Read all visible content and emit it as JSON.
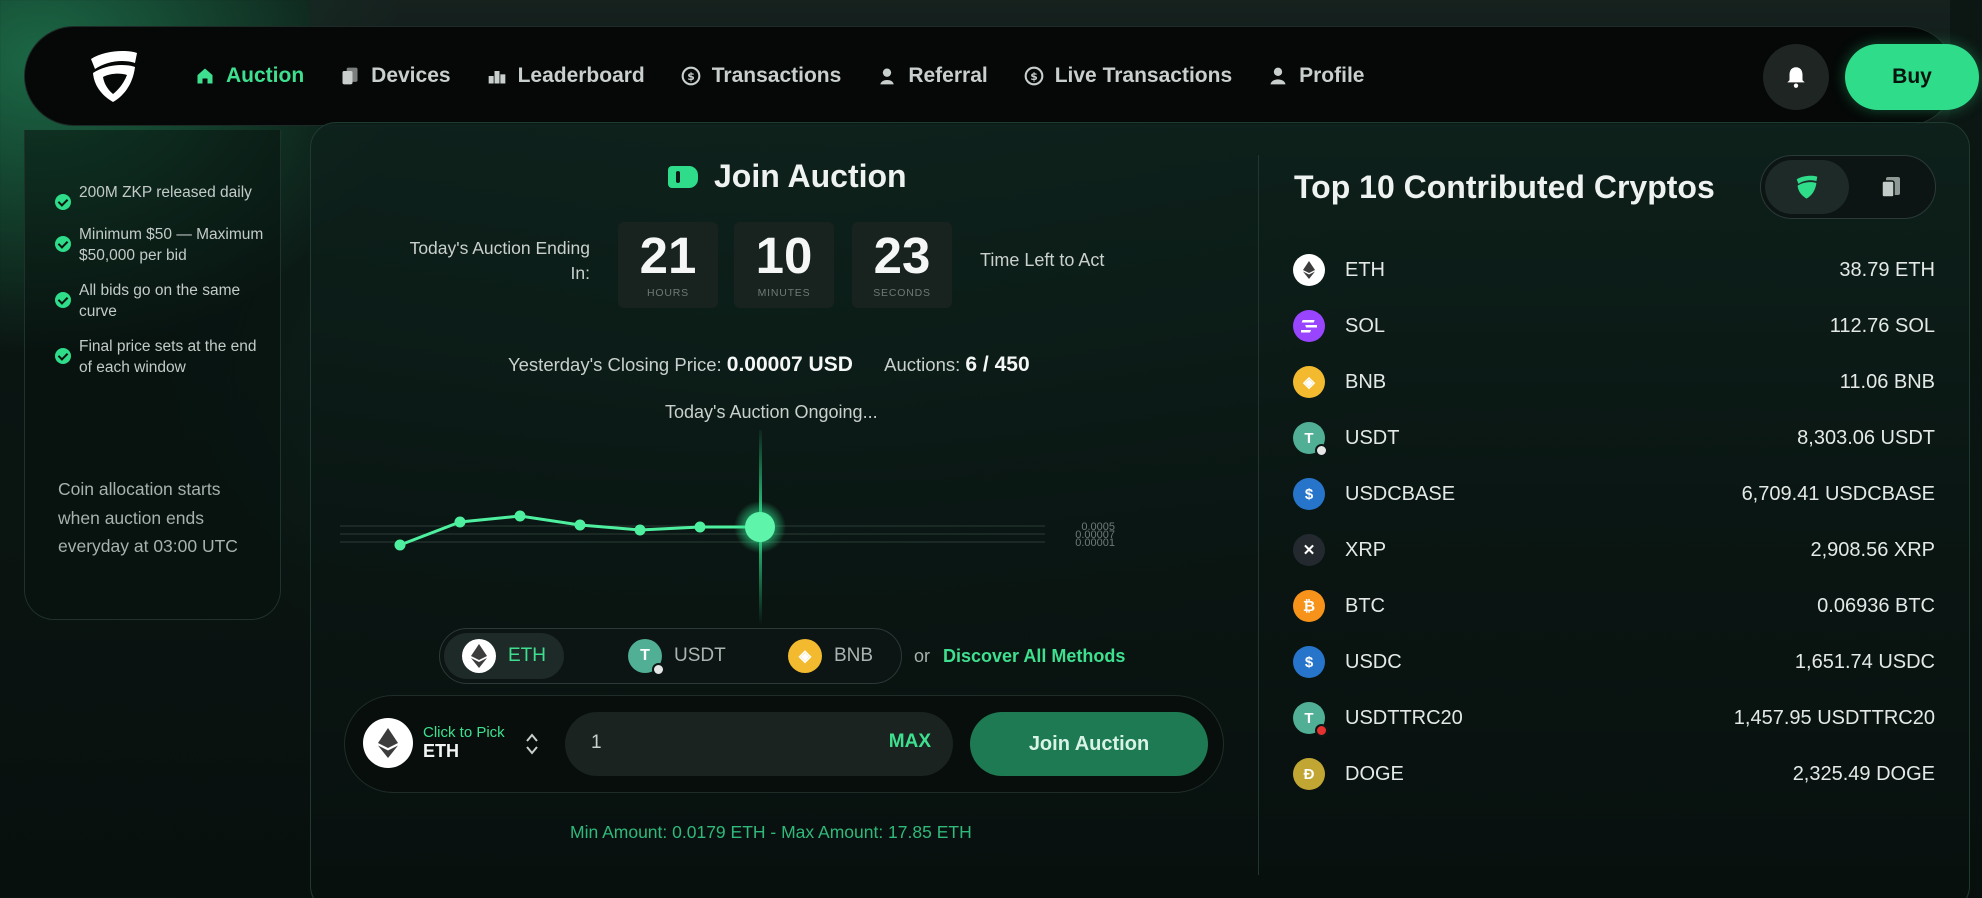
{
  "nav": {
    "items": [
      {
        "label": "Auction",
        "icon": "home-icon",
        "active": true
      },
      {
        "label": "Devices",
        "icon": "devices-icon",
        "active": false
      },
      {
        "label": "Leaderboard",
        "icon": "leaderboard-icon",
        "active": false
      },
      {
        "label": "Transactions",
        "icon": "dollar-coin-icon",
        "active": false
      },
      {
        "label": "Referral",
        "icon": "referral-icon",
        "active": false
      },
      {
        "label": "Live Transactions",
        "icon": "dollar-coin-icon",
        "active": false
      },
      {
        "label": "Profile",
        "icon": "user-icon",
        "active": false
      }
    ],
    "buy_label": "Buy"
  },
  "info": {
    "items": [
      "200M ZKP released daily",
      "Minimum $50 — Maximum $50,000 per bid",
      "All bids go on the same curve",
      "Final price sets at the end of each window"
    ],
    "allocation": "Coin allocation starts when auction ends everyday at 03:00 UTC"
  },
  "auction": {
    "title": "Join Auction",
    "ending_label": "Today's Auction Ending In:",
    "timer": [
      {
        "value": "21",
        "label": "HOURS"
      },
      {
        "value": "10",
        "label": "MINUTES"
      },
      {
        "value": "23",
        "label": "SECONDS"
      }
    ],
    "time_left": "Time Left to Act",
    "closing_label": "Yesterday's Closing Price:",
    "closing_value": "0.00007 USD",
    "auctions_label": "Auctions:",
    "auctions_value": "6 / 450",
    "ongoing": "Today's Auction Ongoing..."
  },
  "chart_data": {
    "type": "line",
    "points": [
      1,
      2,
      3,
      4,
      5,
      6,
      7
    ],
    "values": [
      1e-05,
      4e-05,
      5e-05,
      4e-05,
      3e-05,
      3e-05,
      3e-05
    ],
    "ytick_labels": [
      "0.0005",
      "0.00007",
      "0.00001"
    ],
    "grid": true,
    "current_point_highlighted": true
  },
  "payment": {
    "tabs": [
      {
        "label": "ETH",
        "active": true,
        "color": "#ffffff"
      },
      {
        "label": "USDT",
        "active": false,
        "color": "#50af95"
      },
      {
        "label": "BNB",
        "active": false,
        "color": "#f3ba2f"
      }
    ],
    "or": "or",
    "discover": "Discover All Methods"
  },
  "form": {
    "pick_label": "Click to Pick",
    "pick_value": "ETH",
    "amount": "1",
    "max": "MAX",
    "join": "Join Auction",
    "limits": "Min Amount: 0.0179 ETH - Max Amount: 17.85 ETH"
  },
  "top10": {
    "title": "Top 10 Contributed Cryptos",
    "rows": [
      {
        "name": "ETH",
        "amount": "38.79 ETH",
        "color": "#ffffff"
      },
      {
        "name": "SOL",
        "amount": "112.76 SOL",
        "color": "#9945ff"
      },
      {
        "name": "BNB",
        "amount": "11.06 BNB",
        "color": "#f3ba2f"
      },
      {
        "name": "USDT",
        "amount": "8,303.06 USDT",
        "color": "#50af95"
      },
      {
        "name": "USDCBASE",
        "amount": "6,709.41 USDCBASE",
        "color": "#2775ca"
      },
      {
        "name": "XRP",
        "amount": "2,908.56 XRP",
        "color": "#23292f"
      },
      {
        "name": "BTC",
        "amount": "0.06936 BTC",
        "color": "#f7931a"
      },
      {
        "name": "USDC",
        "amount": "1,651.74 USDC",
        "color": "#2775ca"
      },
      {
        "name": "USDTTRC20",
        "amount": "1,457.95 USDTTRC20",
        "color": "#50af95"
      },
      {
        "name": "DOGE",
        "amount": "2,325.49 DOGE",
        "color": "#c2a633"
      }
    ]
  },
  "colors": {
    "accent": "#2edc8a",
    "background": "#0a1411"
  }
}
